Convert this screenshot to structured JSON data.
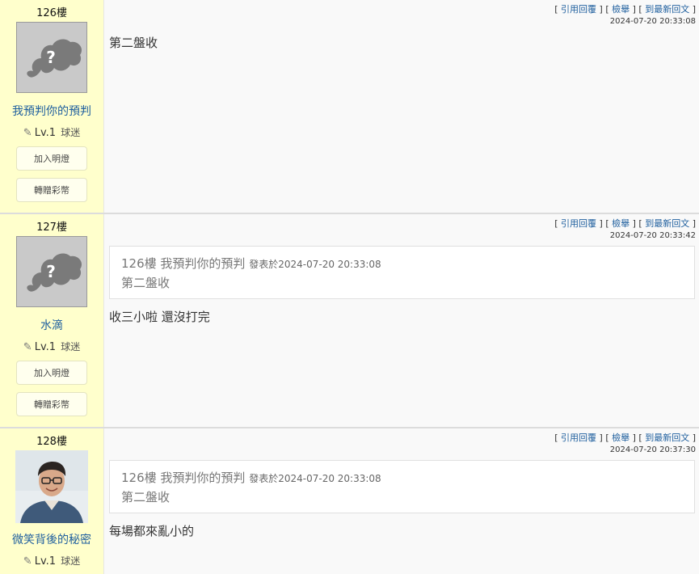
{
  "labels": {
    "quote_reply": "引用回覆",
    "report": "檢舉",
    "latest_reply": "到最新回文",
    "bracket_open": "[",
    "bracket_close": "]",
    "add_light": "加入明燈",
    "gift_coins": "轉贈彩幣",
    "posted_at_prefix": "發表於"
  },
  "posts": [
    {
      "floor": "126樓",
      "user": "我預判你的預判",
      "level": "Lv.1",
      "rank": "球迷",
      "timestamp": "2024-07-20 20:33:08",
      "message": "第二盤收",
      "avatar": "default-avatar"
    },
    {
      "floor": "127樓",
      "user": "水滴",
      "level": "Lv.1",
      "rank": "球迷",
      "timestamp": "2024-07-20 20:33:42",
      "quote": {
        "floor": "126樓",
        "user": "我預判你的預判",
        "posted_at": "2024-07-20 20:33:08",
        "text": "第二盤收"
      },
      "message": "收三小啦 還沒打完",
      "avatar": "default-avatar"
    },
    {
      "floor": "128樓",
      "user": "微笑背後的秘密",
      "level": "Lv.1",
      "rank": "球迷",
      "timestamp": "2024-07-20 20:37:30",
      "quote": {
        "floor": "126樓",
        "user": "我預判你的預判",
        "posted_at": "2024-07-20 20:33:08",
        "text": "第二盤收"
      },
      "message": "每場都來亂小的",
      "avatar": "photo-avatar"
    }
  ]
}
